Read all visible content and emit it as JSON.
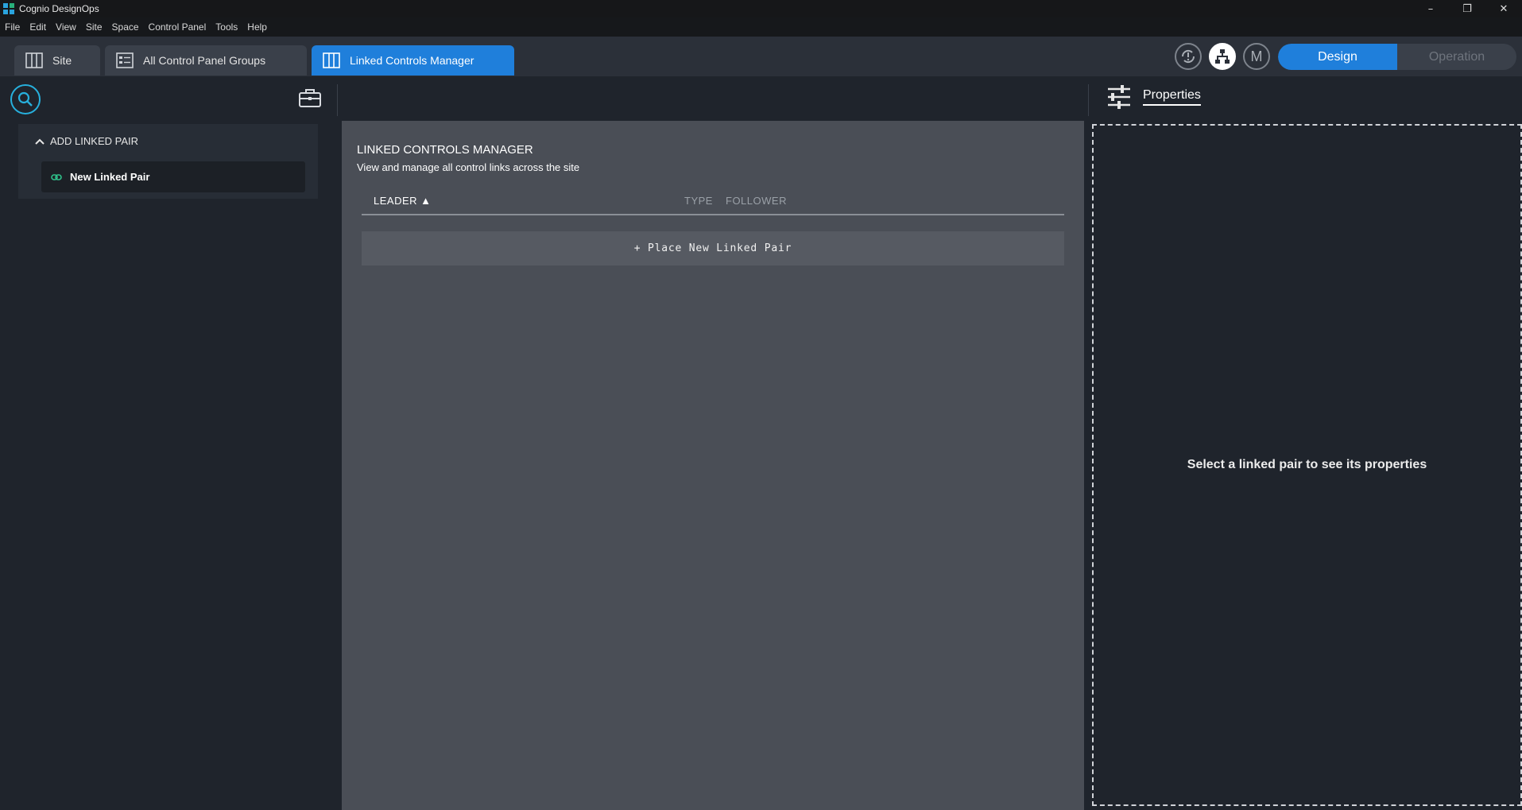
{
  "window": {
    "title": "Cognio DesignOps",
    "controls": {
      "minimize": "–",
      "maximize": "❐",
      "close": "✕"
    },
    "logo_colors": [
      "#2aa3dd",
      "#28b07a",
      "#2aa3dd",
      "#2aa3dd"
    ]
  },
  "menu": [
    "File",
    "Edit",
    "View",
    "Site",
    "Space",
    "Control Panel",
    "Tools",
    "Help"
  ],
  "tabs": [
    {
      "label": "Site",
      "icon": "columns-icon",
      "active": false
    },
    {
      "label": "All Control Panel Groups",
      "icon": "control-panel-icon",
      "active": false
    },
    {
      "label": "Linked Controls Manager",
      "icon": "columns-icon",
      "active": true
    }
  ],
  "header_tools": {
    "sync_icon": "sync-alert-icon",
    "network_icon": "network-icon",
    "user_initial": "M"
  },
  "mode": {
    "design": "Design",
    "operation": "Operation",
    "selected": "Design"
  },
  "toolbar": {
    "search_icon": "search-icon",
    "toolbox_icon": "briefcase-icon",
    "properties_label": "Properties",
    "properties_icon": "sliders-icon"
  },
  "left_panel": {
    "section_title": "ADD LINKED PAIR",
    "items": [
      {
        "label": "New Linked Pair",
        "icon": "link-icon"
      }
    ]
  },
  "center": {
    "title": "LINKED CONTROLS MANAGER",
    "subtitle": "View and manage all control links across the site",
    "columns": {
      "leader": "LEADER ▲",
      "type": "TYPE",
      "follower": "FOLLOWER"
    },
    "place_button": "+ Place New Linked Pair"
  },
  "right_panel": {
    "empty_message": "Select a linked pair to see its properties"
  },
  "colors": {
    "accent": "#1f7fdb",
    "search_ring": "#27b0dd",
    "link_icon": "#2fc08a"
  }
}
